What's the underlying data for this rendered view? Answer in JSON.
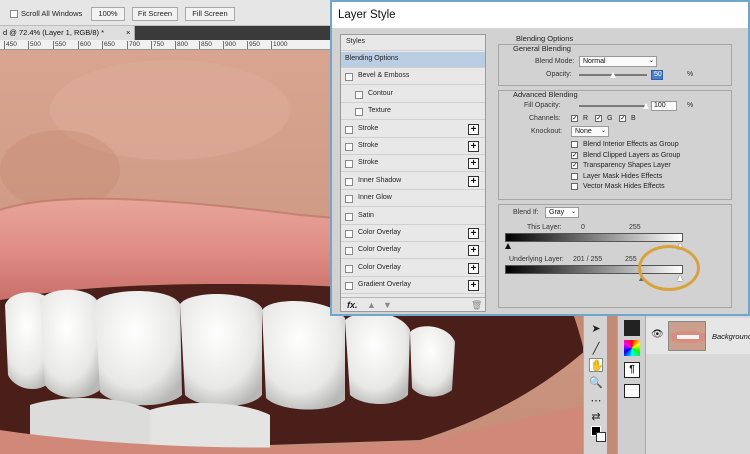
{
  "options_bar": {
    "scroll_all_windows": "Scroll All Windows",
    "btn_100": "100%",
    "btn_fit": "Fit Screen",
    "btn_fill": "Fill Screen"
  },
  "document": {
    "tab_title": "d @ 72.4% (Layer 1, RGB/8) *",
    "close": "×",
    "ruler_ticks": [
      "450",
      "500",
      "550",
      "600",
      "650",
      "700",
      "750",
      "800",
      "850",
      "900",
      "950",
      "1000"
    ]
  },
  "dialog": {
    "title": "Layer Style",
    "styles_header": "Styles",
    "style_items": [
      {
        "label": "Blending Options",
        "selected": true,
        "checkbox": false,
        "plus": false,
        "indent": false
      },
      {
        "label": "Bevel & Emboss",
        "checkbox": true,
        "plus": false,
        "indent": false
      },
      {
        "label": "Contour",
        "checkbox": true,
        "plus": false,
        "indent": true
      },
      {
        "label": "Texture",
        "checkbox": true,
        "plus": false,
        "indent": true
      },
      {
        "label": "Stroke",
        "checkbox": true,
        "plus": true,
        "indent": false
      },
      {
        "label": "Stroke",
        "checkbox": true,
        "plus": true,
        "indent": false
      },
      {
        "label": "Stroke",
        "checkbox": true,
        "plus": true,
        "indent": false
      },
      {
        "label": "Inner Shadow",
        "checkbox": true,
        "plus": true,
        "indent": false
      },
      {
        "label": "Inner Glow",
        "checkbox": true,
        "plus": false,
        "indent": false
      },
      {
        "label": "Satin",
        "checkbox": true,
        "plus": false,
        "indent": false
      },
      {
        "label": "Color Overlay",
        "checkbox": true,
        "plus": true,
        "indent": false
      },
      {
        "label": "Color Overlay",
        "checkbox": true,
        "plus": true,
        "indent": false
      },
      {
        "label": "Color Overlay",
        "checkbox": true,
        "plus": true,
        "indent": false
      },
      {
        "label": "Gradient Overlay",
        "checkbox": true,
        "plus": true,
        "indent": false
      }
    ],
    "footer": {
      "fx": "fx."
    },
    "blending_options": {
      "title": "Blending Options",
      "general_title": "General Blending",
      "blend_mode_label": "Blend Mode:",
      "blend_mode_value": "Normal",
      "opacity_label": "Opacity:",
      "opacity_value": "50",
      "opacity_unit": "%",
      "opacity_fraction": 0.5,
      "advanced_title": "Advanced Blending",
      "fill_opacity_label": "Fill Opacity:",
      "fill_opacity_value": "100",
      "fill_opacity_unit": "%",
      "channels_label": "Channels:",
      "channels": [
        "R",
        "G",
        "B"
      ],
      "knockout_label": "Knockout:",
      "knockout_value": "None",
      "options": [
        {
          "label": "Blend Interior Effects as Group",
          "checked": false
        },
        {
          "label": "Blend Clipped Layers as Group",
          "checked": true
        },
        {
          "label": "Transparency Shapes Layer",
          "checked": true
        },
        {
          "label": "Layer Mask Hides Effects",
          "checked": false
        },
        {
          "label": "Vector Mask Hides Effects",
          "checked": false
        }
      ],
      "blend_if_label": "Blend If:",
      "blend_if_value": "Gray",
      "this_layer_label": "This Layer:",
      "this_layer_min": "0",
      "this_layer_max": "255",
      "underlying_label": "Underlying Layer:",
      "underlying_values": "201   /   255",
      "underlying_max": "255"
    }
  },
  "layers_panel": {
    "layer_name": "Background",
    "eye": "👁"
  },
  "colors": {
    "dialog_border": "#6fa6c9",
    "highlight_ring": "#d9a23a",
    "selected_item": "#b9cde3"
  }
}
